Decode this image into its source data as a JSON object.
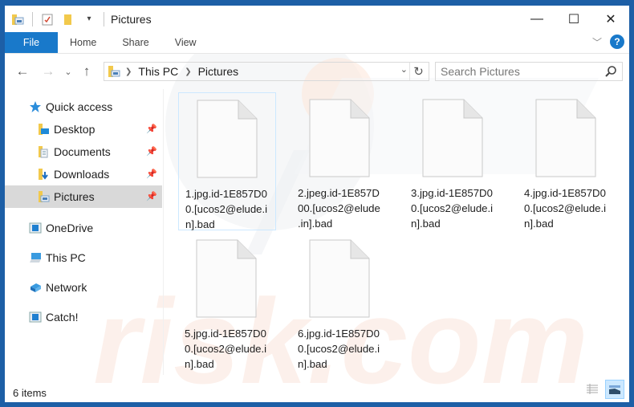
{
  "window": {
    "title": "Pictures",
    "controls": {
      "minimize": "—",
      "maximize": "☐",
      "close": "✕"
    }
  },
  "ribbon": {
    "tabs": [
      {
        "label": "File",
        "active": true
      },
      {
        "label": "Home"
      },
      {
        "label": "Share"
      },
      {
        "label": "View"
      }
    ],
    "help_label": "?",
    "accent_color": "#1979ca"
  },
  "navigation": {
    "back": "←",
    "forward": "→",
    "recent": "⌄",
    "up": "↑",
    "breadcrumb": [
      "This PC",
      "Pictures"
    ],
    "search_placeholder": "Search Pictures",
    "search_value": ""
  },
  "sidebar": {
    "quick_access": {
      "label": "Quick access"
    },
    "pinned": [
      {
        "label": "Desktop",
        "icon": "desktop-folder-icon"
      },
      {
        "label": "Documents",
        "icon": "documents-folder-icon"
      },
      {
        "label": "Downloads",
        "icon": "downloads-folder-icon"
      },
      {
        "label": "Pictures",
        "icon": "pictures-folder-icon",
        "selected": true
      }
    ],
    "roots": [
      {
        "label": "OneDrive",
        "icon": "onedrive-icon"
      },
      {
        "label": "This PC",
        "icon": "this-pc-icon"
      },
      {
        "label": "Network",
        "icon": "network-icon"
      },
      {
        "label": "Catch!",
        "icon": "catch-icon"
      }
    ]
  },
  "files": [
    {
      "name_lines": [
        "1.jpg.id-1E857D0",
        "0.[ucos2@elude.i",
        "n].bad"
      ],
      "selected": true
    },
    {
      "name_lines": [
        "2.jpeg.id-1E857D",
        "00.[ucos2@elude",
        ".in].bad"
      ]
    },
    {
      "name_lines": [
        "3.jpg.id-1E857D0",
        "0.[ucos2@elude.i",
        "n].bad"
      ]
    },
    {
      "name_lines": [
        "4.jpg.id-1E857D0",
        "0.[ucos2@elude.i",
        "n].bad"
      ]
    },
    {
      "name_lines": [
        "5.jpg.id-1E857D0",
        "0.[ucos2@elude.i",
        "n].bad"
      ]
    },
    {
      "name_lines": [
        "6.jpg.id-1E857D0",
        "0.[ucos2@elude.i",
        "n].bad"
      ]
    }
  ],
  "status": {
    "item_count": "6 items"
  }
}
